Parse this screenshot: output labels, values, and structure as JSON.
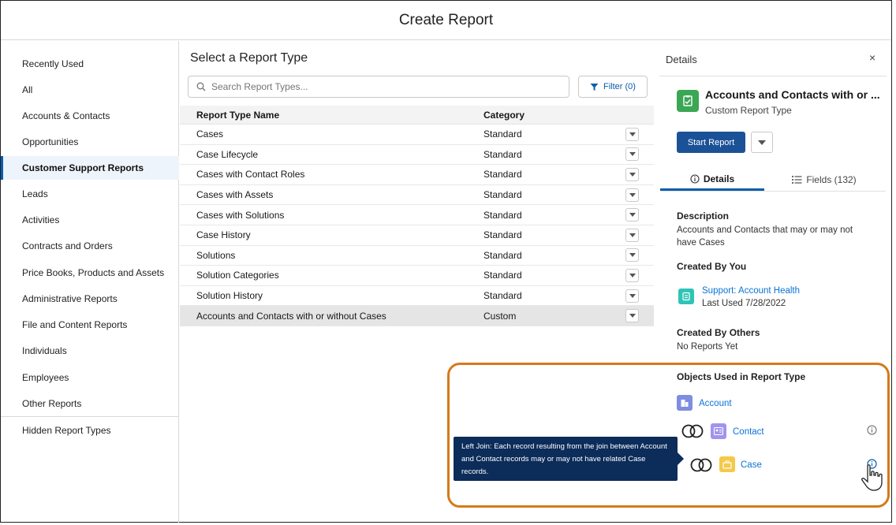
{
  "header": {
    "title": "Create Report"
  },
  "sidebar": {
    "items": [
      {
        "label": "Recently Used"
      },
      {
        "label": "All"
      },
      {
        "label": "Accounts & Contacts"
      },
      {
        "label": "Opportunities"
      },
      {
        "label": "Customer Support Reports",
        "active": true
      },
      {
        "label": "Leads"
      },
      {
        "label": "Activities"
      },
      {
        "label": "Contracts and Orders"
      },
      {
        "label": "Price Books, Products and Assets"
      },
      {
        "label": "Administrative Reports"
      },
      {
        "label": "File and Content Reports"
      },
      {
        "label": "Individuals"
      },
      {
        "label": "Employees"
      },
      {
        "label": "Other Reports"
      }
    ],
    "hidden_label": "Hidden Report Types"
  },
  "main": {
    "title": "Select a Report Type",
    "search_placeholder": "Search Report Types...",
    "filter_label": "Filter (0)",
    "columns": {
      "name": "Report Type Name",
      "category": "Category"
    },
    "rows": [
      {
        "name": "Cases",
        "category": "Standard"
      },
      {
        "name": "Case Lifecycle",
        "category": "Standard"
      },
      {
        "name": "Cases with Contact Roles",
        "category": "Standard"
      },
      {
        "name": "Cases with Assets",
        "category": "Standard"
      },
      {
        "name": "Cases with Solutions",
        "category": "Standard"
      },
      {
        "name": "Case History",
        "category": "Standard"
      },
      {
        "name": "Solutions",
        "category": "Standard"
      },
      {
        "name": "Solution Categories",
        "category": "Standard"
      },
      {
        "name": "Solution History",
        "category": "Standard"
      },
      {
        "name": "Accounts and Contacts with or without Cases",
        "category": "Custom",
        "selected": true
      }
    ]
  },
  "details": {
    "panel_title": "Details",
    "close_glyph": "×",
    "report_name": "Accounts and Contacts with or ...",
    "report_type": "Custom Report Type",
    "start_label": "Start Report",
    "tab_details": "Details",
    "tab_fields": "Fields (132)",
    "description_heading": "Description",
    "description_text": "Accounts and Contacts that may or may not have Cases",
    "created_by_you_heading": "Created By You",
    "your_report_link": "Support: Account Health",
    "your_report_last_used": "Last Used 7/28/2022",
    "created_by_others_heading": "Created By Others",
    "created_by_others_text": "No Reports Yet",
    "objects_heading": "Objects Used in Report Type",
    "objects": [
      {
        "label": "Account",
        "color": "#7f8de1"
      },
      {
        "label": "Contact",
        "color": "#a094ed"
      },
      {
        "label": "Case",
        "color": "#f4c94a"
      }
    ]
  },
  "tooltip": {
    "text": "Left Join: Each record resulting from the join between Account and Contact records may or may not have related Case records."
  },
  "colors": {
    "brand": "#0b5cab",
    "start_button": "#1b5297",
    "highlight_border": "#d57a1a",
    "tooltip_bg": "#0c2c5a",
    "report_icon": "#3ba755",
    "history_icon": "#2ec4b6"
  }
}
